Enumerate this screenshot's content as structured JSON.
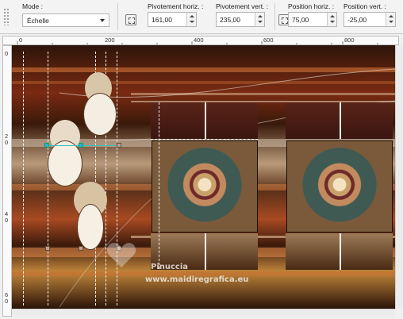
{
  "toolbar": {
    "mode_label": "Mode :",
    "mode_value": "Échelle",
    "rot_h_label": "Pivotement horiz. :",
    "rot_h_value": "161,00",
    "rot_v_label": "Pivotement vert. :",
    "rot_v_value": "235,00",
    "pos_h_label": "Position horiz. :",
    "pos_h_value": "75,00",
    "pos_v_label": "Position vert. :",
    "pos_v_value": "-25,00"
  },
  "ruler": {
    "top_labels": [
      "0",
      "200",
      "400",
      "600",
      "800"
    ],
    "left_labels": [
      "0",
      "2\n0",
      "4\n0",
      "6\n0"
    ]
  },
  "watermark": {
    "line1": "Pinuccia",
    "line2": "www.maidiregrafica.eu"
  }
}
